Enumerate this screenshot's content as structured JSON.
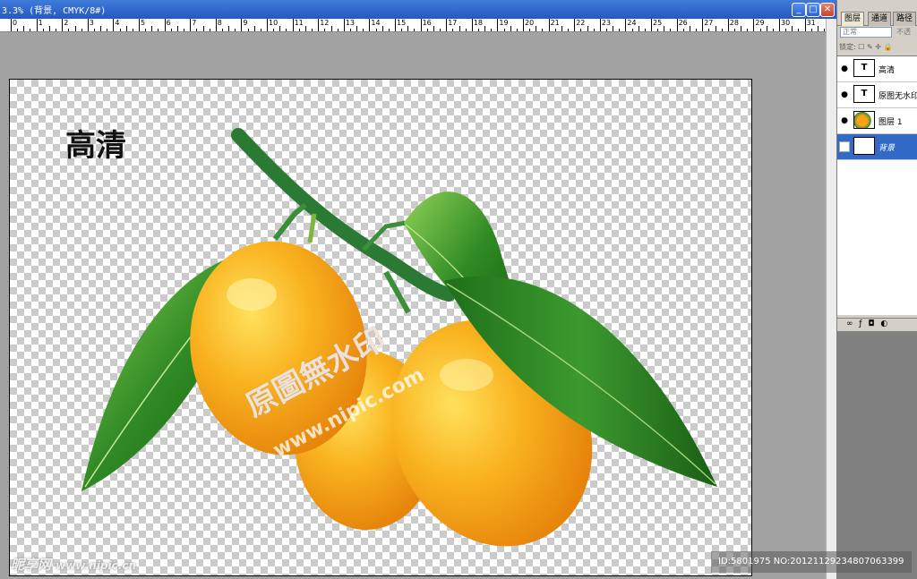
{
  "window": {
    "title": "3.3% (背景, CMYK/8#)",
    "buttons": [
      "minimize",
      "maximize",
      "close"
    ]
  },
  "ruler": {
    "labels": [
      "0",
      "1",
      "2",
      "3",
      "4",
      "5",
      "6",
      "7",
      "8",
      "9",
      "10",
      "11",
      "12",
      "13",
      "14",
      "15",
      "16",
      "17",
      "18",
      "19",
      "20",
      "21",
      "22",
      "23",
      "24",
      "25",
      "26",
      "27",
      "28",
      "29",
      "30",
      "31"
    ]
  },
  "document": {
    "text_layer": "高清",
    "watermark_cn": "原圖無水印",
    "watermark_url": "www.nipic.com"
  },
  "layers_panel": {
    "tabs": [
      "图层",
      "通道",
      "路径"
    ],
    "blend_mode": "正常",
    "opacity_label": "不透",
    "lock_label": "锁定:",
    "layers": [
      {
        "name": "高清",
        "type": "T",
        "visible": true,
        "selected": false
      },
      {
        "name": "原图无水印",
        "type": "T",
        "visible": true,
        "selected": false
      },
      {
        "name": "图层 1",
        "type": "image",
        "visible": true,
        "selected": false
      },
      {
        "name": "背景",
        "type": "background",
        "visible": false,
        "selected": true
      }
    ],
    "bottom_icons": [
      "link-icon",
      "fx-icon",
      "mask-icon",
      "adjustment-icon"
    ]
  },
  "overlays": {
    "site_watermark": "昵享网",
    "site_url": "www.nipic.cn",
    "id_text": "ID:5801975 NO:20121129234807063399"
  },
  "colors": {
    "title_bar": "#2558c4",
    "selected_layer": "#316ac5",
    "orange": "#f7a21a",
    "leaf": "#2f8a24"
  }
}
